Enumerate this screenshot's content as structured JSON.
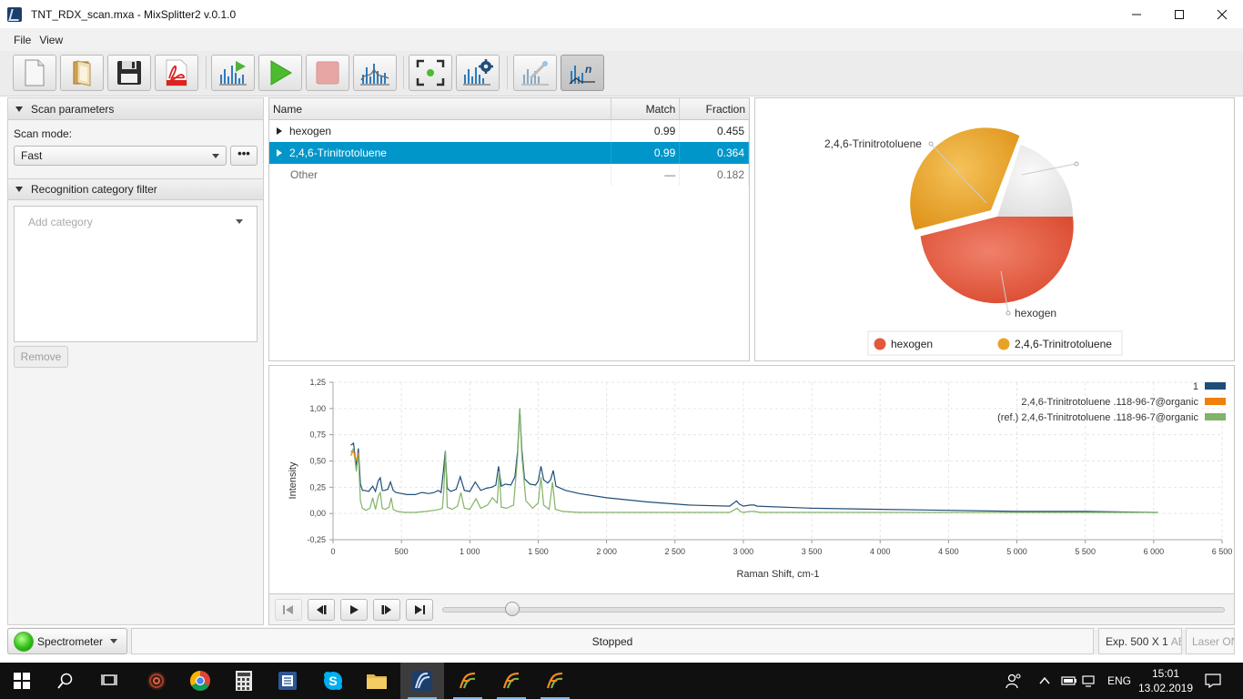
{
  "window": {
    "title": "TNT_RDX_scan.mxa - MixSplitter2 v.0.1.0",
    "minimize_icon": "minimize-icon",
    "maximize_icon": "maximize-icon",
    "close_icon": "close-icon"
  },
  "menu": [
    "File",
    "View"
  ],
  "toolbar": {
    "buttons": [
      "new-file-icon",
      "open-folder-icon",
      "save-icon",
      "pdf-export-icon",
      "scan-spectrum-icon",
      "play-icon",
      "stop-icon",
      "analyze-spectrum-icon",
      "focus-target-icon",
      "spectrum-settings-icon",
      "calibration-icon",
      "normalize-spectrum-icon"
    ],
    "active": "normalize-spectrum-icon"
  },
  "left_panel": {
    "scan_section_title": "Scan parameters",
    "scan_mode_label": "Scan mode:",
    "scan_mode_value": "Fast",
    "more_button_label": "•••",
    "filter_section_title": "Recognition category filter",
    "category_placeholder": "Add category",
    "remove_label": "Remove"
  },
  "results_table": {
    "columns": [
      "Name",
      "Match",
      "Fraction"
    ],
    "rows": [
      {
        "name": "hexogen",
        "match": "0.99",
        "fraction": "0.455",
        "expandable": true,
        "selected": false
      },
      {
        "name": "2,4,6-Trinitrotoluene",
        "match": "0.99",
        "fraction": "0.364",
        "expandable": true,
        "selected": true
      },
      {
        "name": "Other",
        "match": "—",
        "fraction": "0.182",
        "expandable": false,
        "selected": false
      }
    ]
  },
  "pie_chart": {
    "slice_labels": [
      "2,4,6-Trinitrotoluene",
      "hexogen"
    ],
    "legend": [
      {
        "label": "hexogen",
        "color": "#e3583a"
      },
      {
        "label": "2,4,6-Trinitrotoluene",
        "color": "#e8a325"
      }
    ],
    "other_color": "#ececec"
  },
  "chart_data": {
    "type": "line",
    "xlabel": "Raman Shift, cm-1",
    "ylabel": "Intensity",
    "xlim": [
      0,
      6500
    ],
    "ylim": [
      -0.25,
      1.25
    ],
    "x_ticks": [
      "0",
      "500",
      "1 000",
      "1 500",
      "2 000",
      "2 500",
      "3 000",
      "3 500",
      "4 000",
      "4 500",
      "5 000",
      "5 500",
      "6 000",
      "6 500"
    ],
    "y_ticks": [
      "-0,25",
      "0,00",
      "0,25",
      "0,50",
      "0,75",
      "1,00",
      "1,25"
    ],
    "grid": true,
    "legend_position": "top-right",
    "series": [
      {
        "name": "1",
        "color": "#1f4e79",
        "x": [
          130,
          150,
          170,
          185,
          200,
          215,
          230,
          260,
          290,
          310,
          330,
          345,
          360,
          375,
          400,
          420,
          440,
          460,
          500,
          540,
          600,
          650,
          700,
          740,
          770,
          790,
          805,
          820,
          835,
          860,
          900,
          930,
          960,
          1000,
          1040,
          1080,
          1120,
          1160,
          1190,
          1210,
          1230,
          1260,
          1300,
          1330,
          1350,
          1365,
          1380,
          1400,
          1440,
          1480,
          1500,
          1520,
          1540,
          1570,
          1590,
          1610,
          1630,
          1700,
          1800,
          2000,
          2300,
          2600,
          2900,
          2950,
          2970,
          3000,
          3050,
          3080,
          3100,
          3500,
          4000,
          4500,
          5000,
          5500,
          6000,
          6030
        ],
        "y": [
          0.65,
          0.67,
          0.45,
          0.62,
          0.28,
          0.22,
          0.22,
          0.21,
          0.26,
          0.21,
          0.31,
          0.34,
          0.22,
          0.22,
          0.23,
          0.3,
          0.22,
          0.2,
          0.19,
          0.18,
          0.18,
          0.2,
          0.19,
          0.2,
          0.22,
          0.2,
          0.38,
          0.59,
          0.24,
          0.21,
          0.23,
          0.35,
          0.22,
          0.21,
          0.3,
          0.22,
          0.24,
          0.25,
          0.27,
          0.45,
          0.26,
          0.28,
          0.27,
          0.35,
          0.6,
          1.0,
          0.62,
          0.33,
          0.28,
          0.27,
          0.31,
          0.45,
          0.32,
          0.29,
          0.32,
          0.41,
          0.26,
          0.22,
          0.19,
          0.15,
          0.11,
          0.08,
          0.07,
          0.12,
          0.09,
          0.07,
          0.08,
          0.08,
          0.07,
          0.05,
          0.04,
          0.03,
          0.02,
          0.02,
          0.01,
          0.01
        ]
      },
      {
        "name": "2,4,6-Trinitrotoluene .118-96-7@organic",
        "color": "#f07f0c",
        "x": [
          130,
          150,
          170,
          185
        ],
        "y": [
          0.55,
          0.6,
          0.5,
          0.58
        ]
      },
      {
        "name": "(ref.) 2,4,6-Trinitrotoluene .118-96-7@organic",
        "color": "#82b366",
        "x": [
          130,
          150,
          170,
          185,
          200,
          215,
          240,
          270,
          290,
          310,
          330,
          345,
          360,
          380,
          410,
          425,
          440,
          470,
          520,
          600,
          680,
          740,
          780,
          800,
          810,
          822,
          835,
          870,
          910,
          935,
          960,
          1000,
          1045,
          1080,
          1130,
          1165,
          1200,
          1215,
          1230,
          1270,
          1320,
          1350,
          1365,
          1380,
          1410,
          1460,
          1500,
          1520,
          1540,
          1580,
          1605,
          1625,
          1680,
          1800,
          2000,
          2500,
          2900,
          2955,
          2975,
          3000,
          3050,
          3080,
          3120,
          3500,
          4000,
          5000,
          6000,
          6030
        ],
        "y": [
          0.58,
          0.62,
          0.4,
          0.57,
          0.12,
          0.05,
          0.03,
          0.05,
          0.15,
          0.04,
          0.16,
          0.2,
          0.05,
          0.04,
          0.06,
          0.15,
          0.04,
          0.02,
          0.01,
          0.01,
          0.02,
          0.03,
          0.04,
          0.05,
          0.22,
          0.6,
          0.06,
          0.04,
          0.07,
          0.2,
          0.05,
          0.04,
          0.14,
          0.05,
          0.08,
          0.15,
          0.1,
          0.4,
          0.06,
          0.05,
          0.08,
          0.55,
          1.0,
          0.56,
          0.12,
          0.05,
          0.1,
          0.35,
          0.08,
          0.04,
          0.3,
          0.04,
          0.02,
          0.01,
          0.01,
          0.01,
          0.01,
          0.05,
          0.02,
          0.01,
          0.02,
          0.02,
          0.01,
          0.01,
          0.01,
          0.01,
          0.01,
          0.01
        ]
      }
    ]
  },
  "player": {
    "buttons": [
      "skip-to-start-icon",
      "step-back-icon",
      "play-icon",
      "step-forward-icon",
      "skip-to-end-icon"
    ],
    "position": 0.09
  },
  "status_bar": {
    "device_label": "Spectrometer",
    "status_text": "Stopped",
    "exposure_text": "Exp. 500 X 1",
    "exposure_overflow": "AE",
    "laser_text": "Laser ON"
  },
  "taskbar": {
    "apps": [
      "windows-start-icon",
      "search-icon",
      "task-view-icon",
      "spiral-app-icon",
      "chrome-icon",
      "calculator-icon",
      "office-app-icon",
      "skype-icon",
      "file-explorer-icon",
      "mixsplitter-icon",
      "mixsplitter-icon-2",
      "mixsplitter-icon-3",
      "mixsplitter-icon-4"
    ],
    "language": "ENG",
    "time": "15:01",
    "date": "13.02.2019"
  }
}
